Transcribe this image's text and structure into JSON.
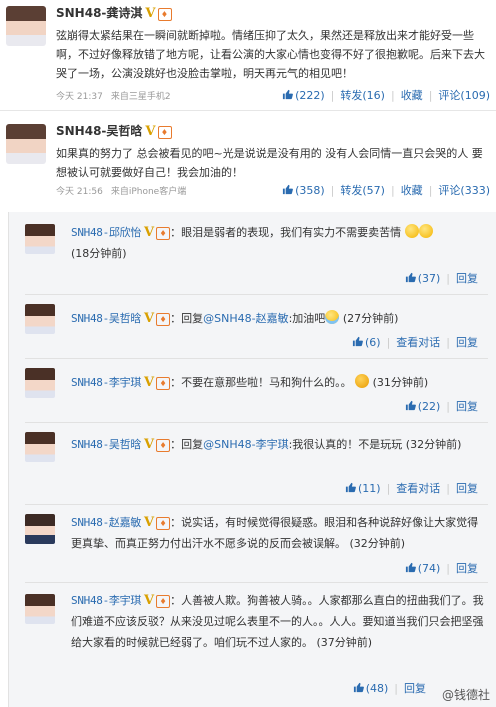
{
  "posts": [
    {
      "name": "SNH48-龚诗淇",
      "v": "V",
      "text": "弦崩得太紧结果在一瞬间就断掉啦。情绪压抑了太久，果然还是释放出来才能好受一些啊，不过好像释放错了地方呢，让看公演的大家心情也变得不好了很抱歉呢。后来下去大哭了一场，公演没跳好也没脸击掌啦，明天再元气的相见吧！",
      "time": "今天 21:37",
      "source": "来自三星手机2",
      "likes": "(222)",
      "repost": "转发(16)",
      "fav": "收藏",
      "comment": "评论(109)"
    },
    {
      "name": "SNH48-吴哲晗",
      "v": "V",
      "text": "如果真的努力了 总会被看见的吧~光是说说是没有用的 没有人会同情一直只会哭的人 要想被认可就要做好自己！我会加油的！",
      "time": "今天 21:56",
      "source": "来自iPhone客户端",
      "likes": "(358)",
      "repost": "转发(57)",
      "fav": "收藏",
      "comment": "评论(333)"
    }
  ],
  "replies": [
    {
      "name": "SNH48-邱欣怡",
      "v": "V",
      "text": "：眼泪是弱者的表现，我们有实力不需要卖苦情",
      "time": "(18分钟前)",
      "likes": "(37)",
      "reply": "回复",
      "action2": ""
    },
    {
      "name": "SNH48-吴哲晗",
      "v": "V",
      "prefix": "：回复",
      "at": "@SNH48-赵嘉敏",
      "text": ":加油吧",
      "time": "(27分钟前)",
      "likes": "(6)",
      "reply": "回复",
      "action2": "查看对话"
    },
    {
      "name": "SNH48-李宇琪",
      "v": "V",
      "text": "：不要在意那些啦！马和狗什么的。。",
      "time": "(31分钟前)",
      "likes": "(22)",
      "reply": "回复",
      "action2": ""
    },
    {
      "name": "SNH48-吴哲晗",
      "v": "V",
      "prefix": "：回复",
      "at": "@SNH48-李宇琪",
      "text": ":我很认真的！不是玩玩 (32分钟前)",
      "time": "",
      "likes": "(11)",
      "reply": "回复",
      "action2": "查看对话"
    },
    {
      "name": "SNH48-赵嘉敏",
      "v": "V",
      "text": "：说实话，有时候觉得很疑惑。眼泪和各种说辞好像让大家觉得更真挚、而真正努力付出汗水不愿多说的反而会被误解。",
      "time": "(32分钟前)",
      "likes": "(74)",
      "reply": "回复",
      "action2": ""
    },
    {
      "name": "SNH48-李宇琪",
      "v": "V",
      "text": "：人善被人欺。狗善被人骑。。人家都那么直白的扭曲我们了。我们难道不应该反驳？从来没见过呢么表里不一的人。。人人。要知道当我们只会把坚强给大家看的时候就已经弱了。咱们玩不过人家的。",
      "time": "(37分钟前)",
      "likes": "(48)",
      "reply": "回复",
      "action2": ""
    }
  ],
  "watermark": "@钱德社"
}
